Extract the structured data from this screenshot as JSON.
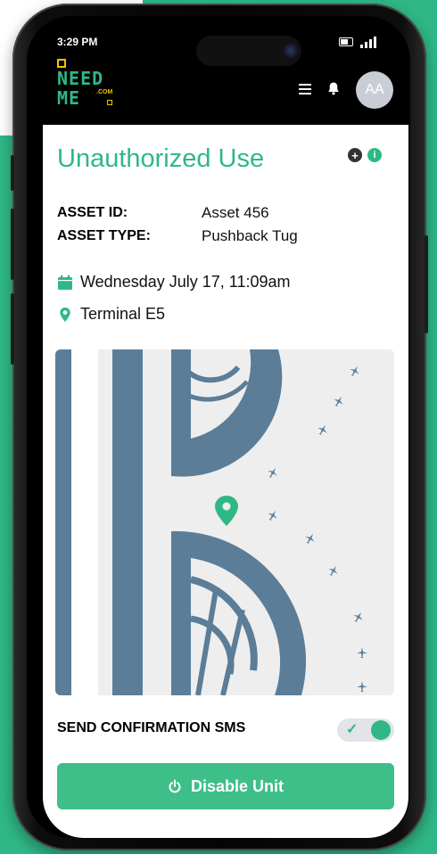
{
  "status_bar": {
    "time": "3:29 PM"
  },
  "app": {
    "logo": {
      "line1": "NEED",
      "line2": "ME",
      "com": ".COM"
    },
    "avatar_initials": "AA"
  },
  "page": {
    "title": "Unauthorized Use",
    "asset_id_label": "ASSET ID:",
    "asset_id_value": "Asset 456",
    "asset_type_label": "ASSET TYPE:",
    "asset_type_value": "Pushback Tug",
    "datetime": "Wednesday July 17, 11:09am",
    "location": "Terminal E5"
  },
  "sms": {
    "label": "SEND CONFIRMATION SMS",
    "enabled": true
  },
  "action": {
    "disable_label": "Disable Unit"
  },
  "colors": {
    "brand_green": "#2fb886",
    "map_blue": "#5b7d98",
    "logo_yellow": "#f2c200"
  },
  "icons": [
    "hamburger-menu-icon",
    "bell-icon",
    "add-icon",
    "info-icon",
    "calendar-icon",
    "location-pin-icon",
    "plane-icon",
    "power-icon",
    "check-icon"
  ]
}
